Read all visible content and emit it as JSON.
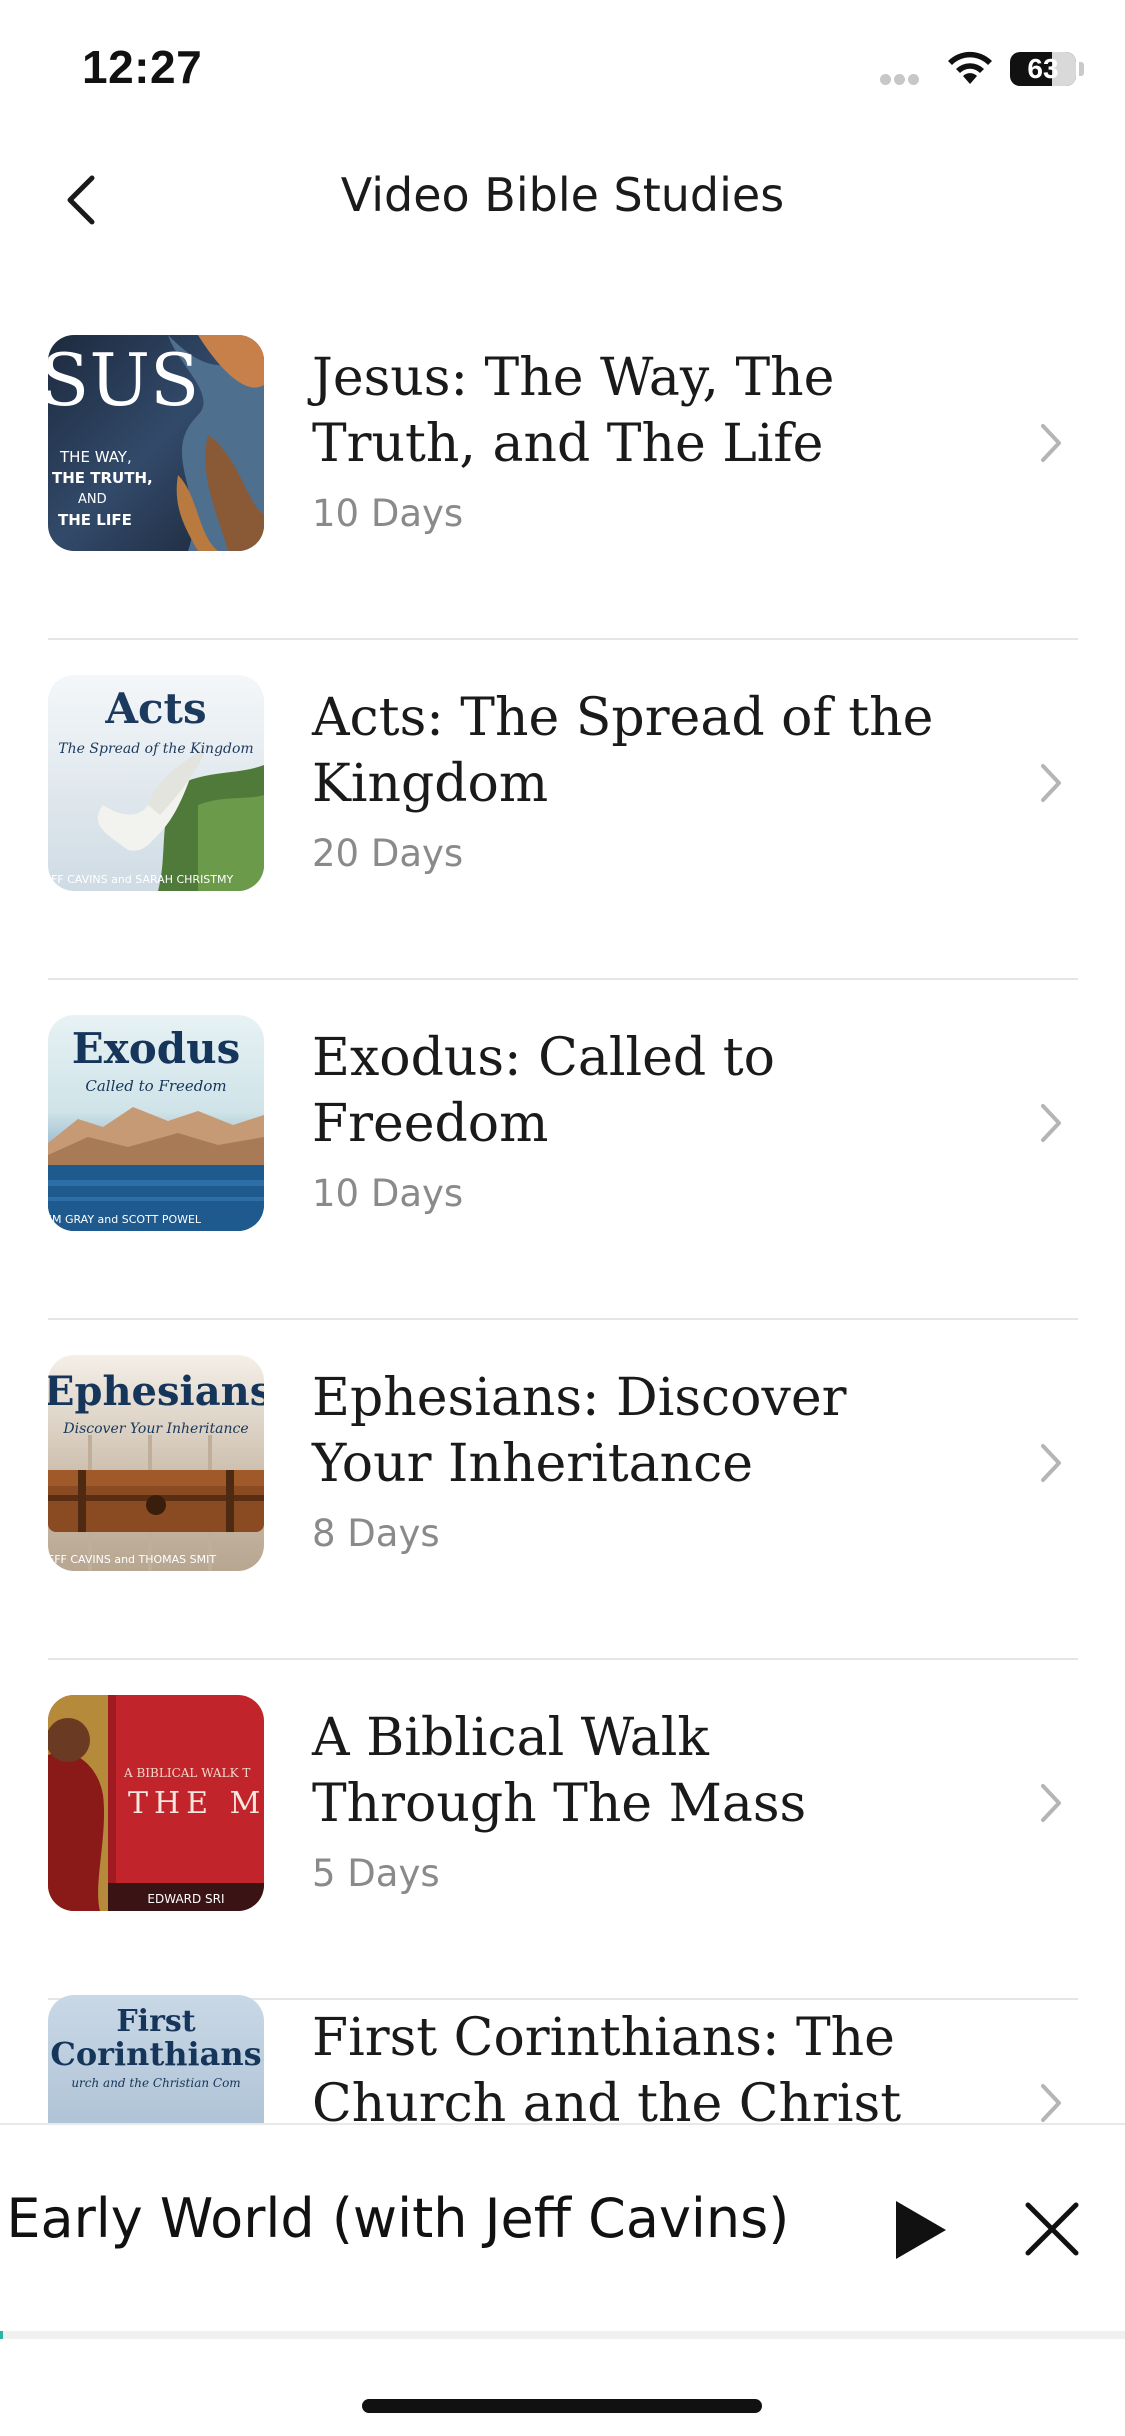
{
  "status_bar": {
    "time": "12:27",
    "battery": "63"
  },
  "header": {
    "title": "Video Bible Studies"
  },
  "studies": [
    {
      "title_line1": "Jesus: The Way, The",
      "title_line2": "Truth, and The Life",
      "days": "10 Days",
      "thumb": {
        "big": "SUS",
        "lines": [
          "THE WAY,",
          "THE TRUTH,",
          "AND",
          "THE LIFE"
        ]
      }
    },
    {
      "title_line1": "Acts: The Spread of the",
      "title_line2": "Kingdom",
      "days": "20 Days",
      "thumb": {
        "big": "Acts",
        "sub": "The Spread of the Kingdom",
        "footer": "EFF CAVINS and SARAH CHRISTMY"
      }
    },
    {
      "title_line1": "Exodus: Called to",
      "title_line2": "Freedom",
      "days": "10 Days",
      "thumb": {
        "big": "Exodus",
        "sub": "Called to Freedom",
        "footer": "TIM GRAY and SCOTT POWEL"
      }
    },
    {
      "title_line1": "Ephesians: Discover",
      "title_line2": "Your Inheritance",
      "days": "8 Days",
      "thumb": {
        "big": "Ephesians",
        "sub": "Discover Your Inheritance",
        "footer": "JEFF CAVINS and THOMAS SMIT"
      }
    },
    {
      "title_line1": "A Biblical Walk",
      "title_line2": "Through The Mass",
      "days": "5 Days",
      "thumb": {
        "small": "A BIBLICAL WALK T",
        "big": "THE M",
        "footer": "EDWARD SRI"
      }
    },
    {
      "title_line1": "First  Corinthians: The",
      "title_line2": "Church and the Christ",
      "days": "",
      "thumb": {
        "big1": "First",
        "big2": "Corinthians",
        "sub": "urch and the Christian Com"
      }
    }
  ],
  "mini_player": {
    "track": "e Early World (with Jeff Cavins)",
    "progress": 0.003
  },
  "colors": {
    "accent": "#2bb3a3",
    "divider": "#e5e5e5",
    "muted": "#8a8a8a"
  }
}
